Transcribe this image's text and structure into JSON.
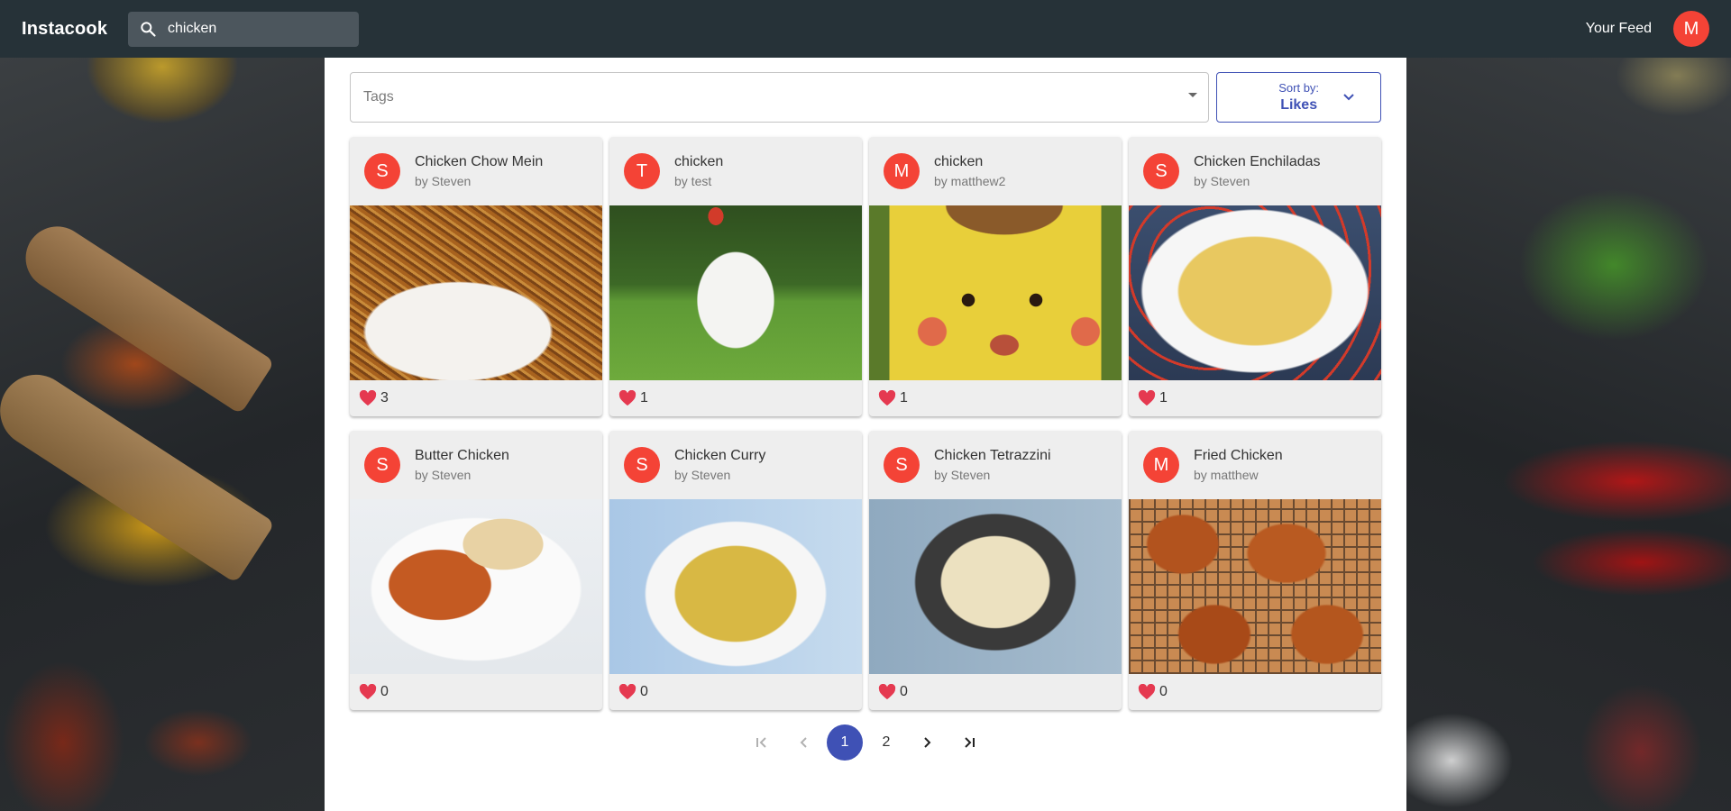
{
  "header": {
    "brand": "Instacook",
    "search_value": "chicken",
    "feed_label": "Your Feed",
    "user_initial": "M"
  },
  "filters": {
    "tags_placeholder": "Tags",
    "sort_label": "Sort by:",
    "sort_value": "Likes"
  },
  "recipes": [
    {
      "title": "Chicken Chow Mein",
      "author": "by Steven",
      "initial": "S",
      "likes": "3",
      "image": "noodles"
    },
    {
      "title": "chicken",
      "author": "by test",
      "initial": "T",
      "likes": "1",
      "image": "chicken"
    },
    {
      "title": "chicken",
      "author": "by matthew2",
      "initial": "M",
      "likes": "1",
      "image": "pikachu"
    },
    {
      "title": "Chicken Enchiladas",
      "author": "by Steven",
      "initial": "S",
      "likes": "1",
      "image": "enchiladas"
    },
    {
      "title": "Butter Chicken",
      "author": "by Steven",
      "initial": "S",
      "likes": "0",
      "image": "butter-chicken"
    },
    {
      "title": "Chicken Curry",
      "author": "by Steven",
      "initial": "S",
      "likes": "0",
      "image": "curry"
    },
    {
      "title": "Chicken Tetrazzini",
      "author": "by Steven",
      "initial": "S",
      "likes": "0",
      "image": "tetrazzini"
    },
    {
      "title": "Fried Chicken",
      "author": "by matthew",
      "initial": "M",
      "likes": "0",
      "image": "fried-chicken"
    }
  ],
  "pagination": {
    "pages": [
      "1",
      "2"
    ],
    "current": "1"
  },
  "colors": {
    "topbar": "#263238",
    "accent": "#3f51b5",
    "avatar": "#f44336",
    "heart": "#e53950"
  }
}
